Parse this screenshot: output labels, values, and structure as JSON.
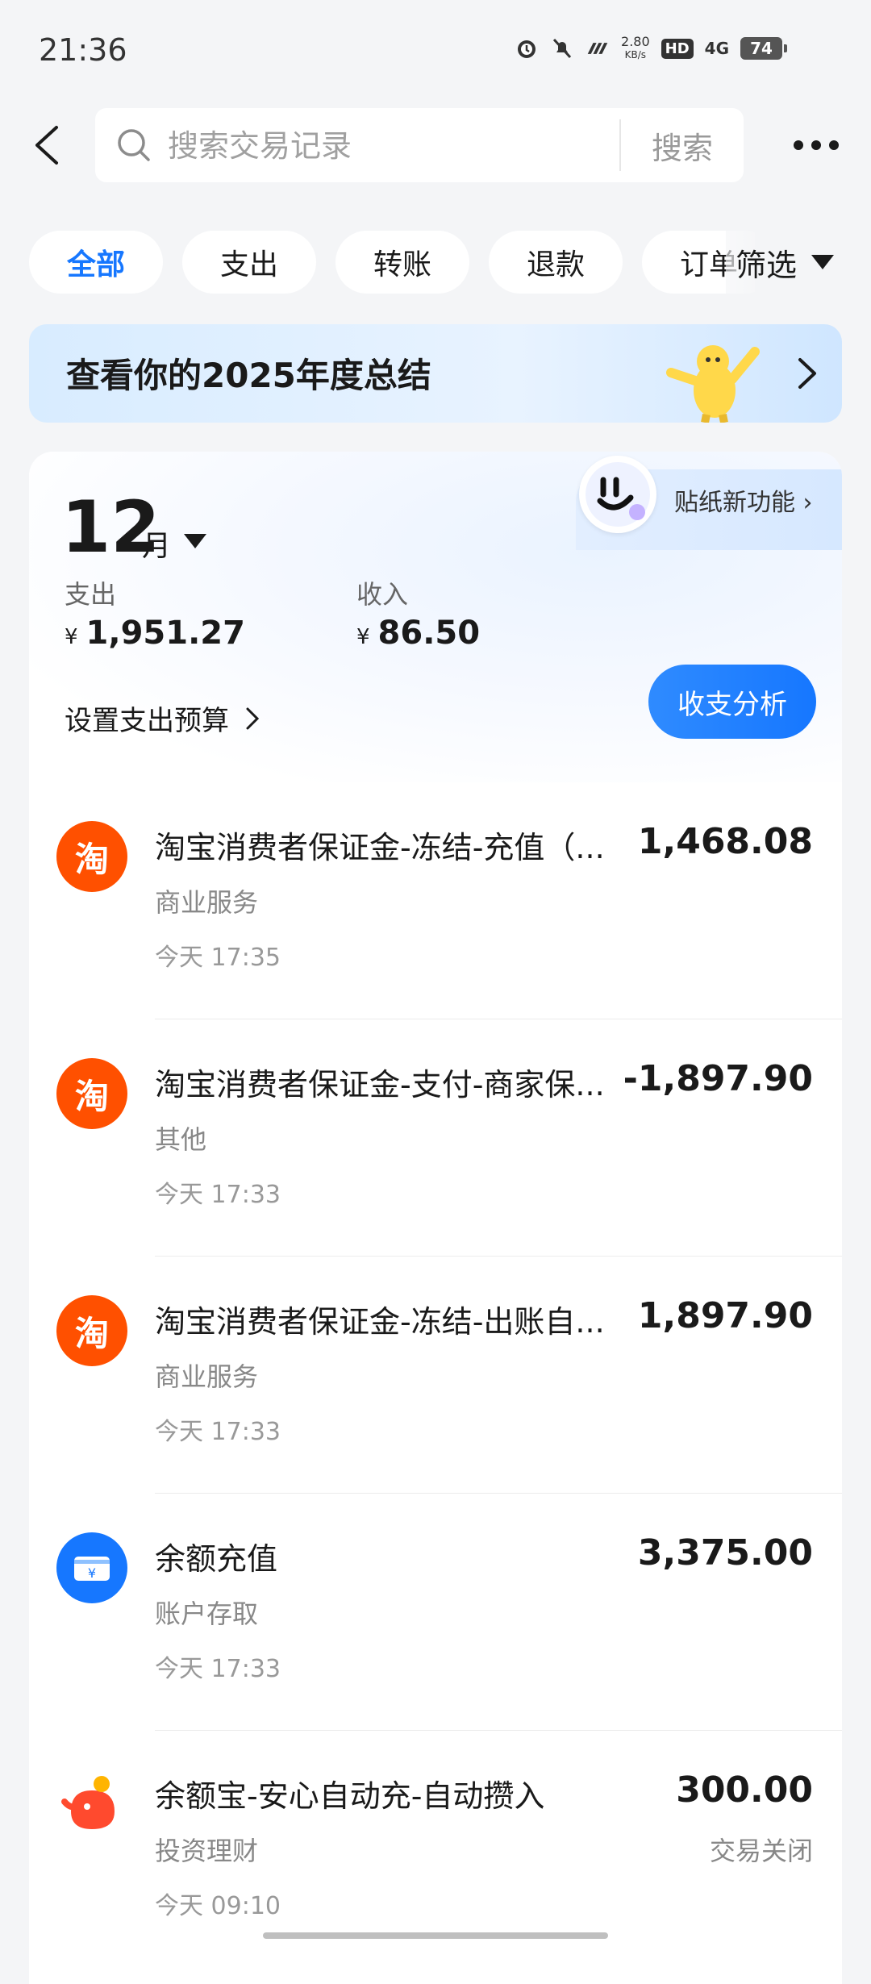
{
  "status_bar": {
    "time": "21:36",
    "net_speed_value": "2.80",
    "net_speed_unit": "KB/s",
    "hd": "HD",
    "network": "4G",
    "battery": "74"
  },
  "header": {
    "search_placeholder": "搜索交易记录",
    "search_button": "搜索"
  },
  "filters": {
    "chips": [
      "全部",
      "支出",
      "转账",
      "退款",
      "订单"
    ],
    "active": "全部",
    "filter_label": "筛选"
  },
  "banner": {
    "title": "查看你的2025年度总结"
  },
  "summary": {
    "month_number": "12",
    "month_unit": "月",
    "expense_label": "支出",
    "expense_value": "1,951.27",
    "income_label": "收入",
    "income_value": "86.50",
    "currency": "¥",
    "budget_label": "设置支出预算",
    "analysis_button": "收支分析",
    "sticker_label": "贴纸新功能"
  },
  "transactions": [
    {
      "icon": "taobao-icon",
      "icon_text": "淘",
      "title": "淘宝消费者保证金-冻结-充值（...",
      "category": "商业服务",
      "time": "今天 17:35",
      "amount": "1,468.08",
      "status": ""
    },
    {
      "icon": "taobao-icon",
      "icon_text": "淘",
      "title": "淘宝消费者保证金-支付-商家保...",
      "category": "其他",
      "time": "今天 17:33",
      "amount": "-1,897.90",
      "status": ""
    },
    {
      "icon": "taobao-icon",
      "icon_text": "淘",
      "title": "淘宝消费者保证金-冻结-出账自...",
      "category": "商业服务",
      "time": "今天 17:33",
      "amount": "1,897.90",
      "status": ""
    },
    {
      "icon": "balance-topup-icon",
      "icon_text": "¥",
      "title": "余额充值",
      "category": "账户存取",
      "time": "今天 17:33",
      "amount": "3,375.00",
      "status": ""
    },
    {
      "icon": "yuebao-icon",
      "icon_text": "",
      "title": "余额宝-安心自动充-自动攒入",
      "category": "投资理财",
      "time": "今天 09:10",
      "amount": "300.00",
      "status": "交易关闭"
    }
  ],
  "colors": {
    "accent": "#1677ff",
    "taobao": "#ff5000",
    "yuebao": "#ff4a2e"
  }
}
